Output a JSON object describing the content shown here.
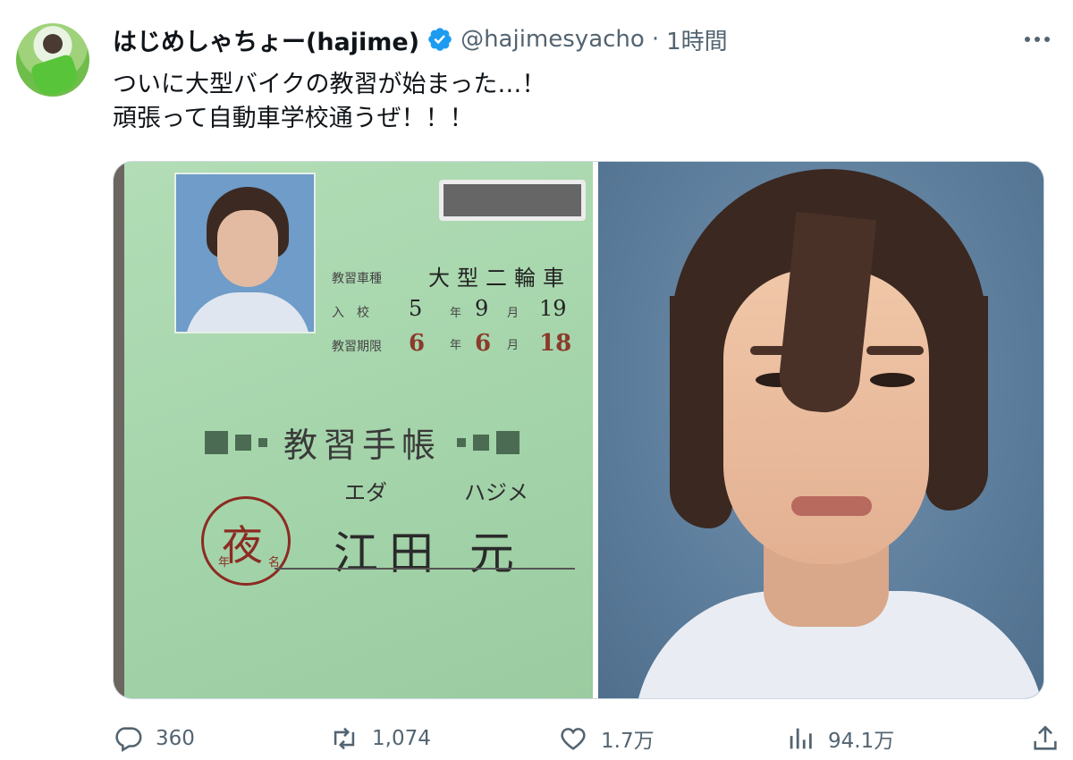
{
  "tweet": {
    "display_name": "はじめしゃちょー(hajime)",
    "handle": "@hajimesyacho",
    "separator": "·",
    "time": "1時間",
    "text_lines": [
      "ついに大型バイクの教習が始まった…！",
      "頑張って自動車学校通うぜ！！！"
    ]
  },
  "card": {
    "course_label": "教習車種",
    "course_value": "大型二輪車",
    "enroll_label": "入　校",
    "enroll_year": "5",
    "enroll_month": "9",
    "enroll_day": "19",
    "expiry_label": "教習期限",
    "expiry_year": "6",
    "expiry_month": "6",
    "expiry_day": "18",
    "unit_year": "年",
    "unit_month": "月",
    "title": "教習手帳",
    "stamp_char": "夜",
    "stamp_left": "年",
    "stamp_right": "名",
    "furigana_family": "エダ",
    "furigana_given": "ハジメ",
    "name": "江田 元"
  },
  "metrics": {
    "replies": "360",
    "retweets": "1,074",
    "likes": "1.7万",
    "views": "94.1万"
  },
  "colors": {
    "verified": "#1d9bf0",
    "icon_grey": "#536471",
    "card_green": "#a8d8ae"
  }
}
